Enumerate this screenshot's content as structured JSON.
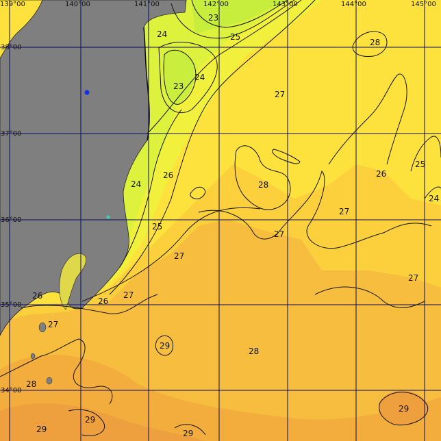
{
  "map": {
    "lon_ticks": [
      {
        "id": "lon-139",
        "text": "139°00"
      },
      {
        "id": "lon-140",
        "text": "140°00"
      },
      {
        "id": "lon-141",
        "text": "141°00"
      },
      {
        "id": "lon-142",
        "text": "142°00"
      },
      {
        "id": "lon-143",
        "text": "143°00"
      },
      {
        "id": "lon-144",
        "text": "144°00"
      },
      {
        "id": "lon-145",
        "text": "145°00"
      }
    ],
    "lat_ticks": [
      {
        "id": "lat-38",
        "text": "38°00"
      },
      {
        "id": "lat-37",
        "text": "37°00"
      },
      {
        "id": "lat-36",
        "text": "36°00"
      },
      {
        "id": "lat-35",
        "text": "35°00"
      },
      {
        "id": "lat-34",
        "text": "34°00"
      }
    ],
    "contour_labels": [
      "23",
      "24",
      "25",
      "23",
      "24",
      "27",
      "28",
      "24",
      "26",
      "28",
      "26",
      "25",
      "24",
      "27",
      "25",
      "27",
      "27",
      "27",
      "26",
      "26",
      "27",
      "29",
      "28",
      "28",
      "29",
      "29",
      "29"
    ],
    "colors": {
      "land": "#7f7f7f",
      "grid": "#0a0a66",
      "isoline": "#111111",
      "sst_23": "#d2f23c",
      "sst_24": "#ecf23c",
      "sst_25": "#f7ea3e",
      "sst_26": "#fad43a",
      "sst_27": "#f8c03c",
      "sst_28": "#f4b23c",
      "sst_29": "#f0a23c",
      "marker": "#1530e0"
    }
  }
}
